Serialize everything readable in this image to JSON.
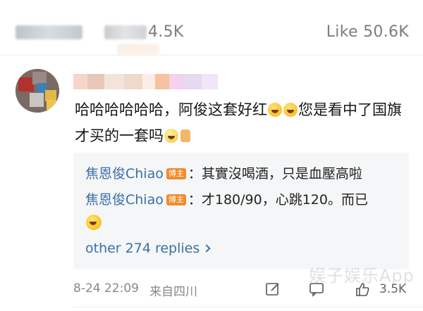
{
  "header": {
    "repost_label_blurred": "Repost",
    "comment_count": "4.5K",
    "like_label": "Like 50.6K"
  },
  "comment": {
    "text_part1": "哈哈哈哈哈哈，阿俊这套好红",
    "text_part2": "您是看中了国旗才买的一套吗",
    "time": "8-24 22:09",
    "location": "来自四川",
    "like_count": "3.5K"
  },
  "replies": [
    {
      "author": "焦恩俊Chiao",
      "badge": "博主",
      "text": "：其實沒喝酒，只是血壓高啦"
    },
    {
      "author": "焦恩俊Chiao",
      "badge": "博主",
      "text": "：才180/90，心跳120。而已"
    }
  ],
  "more_replies": "other 274 replies",
  "watermark": "娱子娱乐App",
  "colors": {
    "link": "#3b6fa6",
    "badge": "#f28a2e",
    "muted": "#888888",
    "reply_bg": "#f5f6f7"
  },
  "icons": [
    "edit-icon",
    "comment-icon",
    "thumb-up-icon",
    "chevron-right-icon",
    "laughing-emoji",
    "sweating-emoji",
    "thumb-up-emoji"
  ]
}
